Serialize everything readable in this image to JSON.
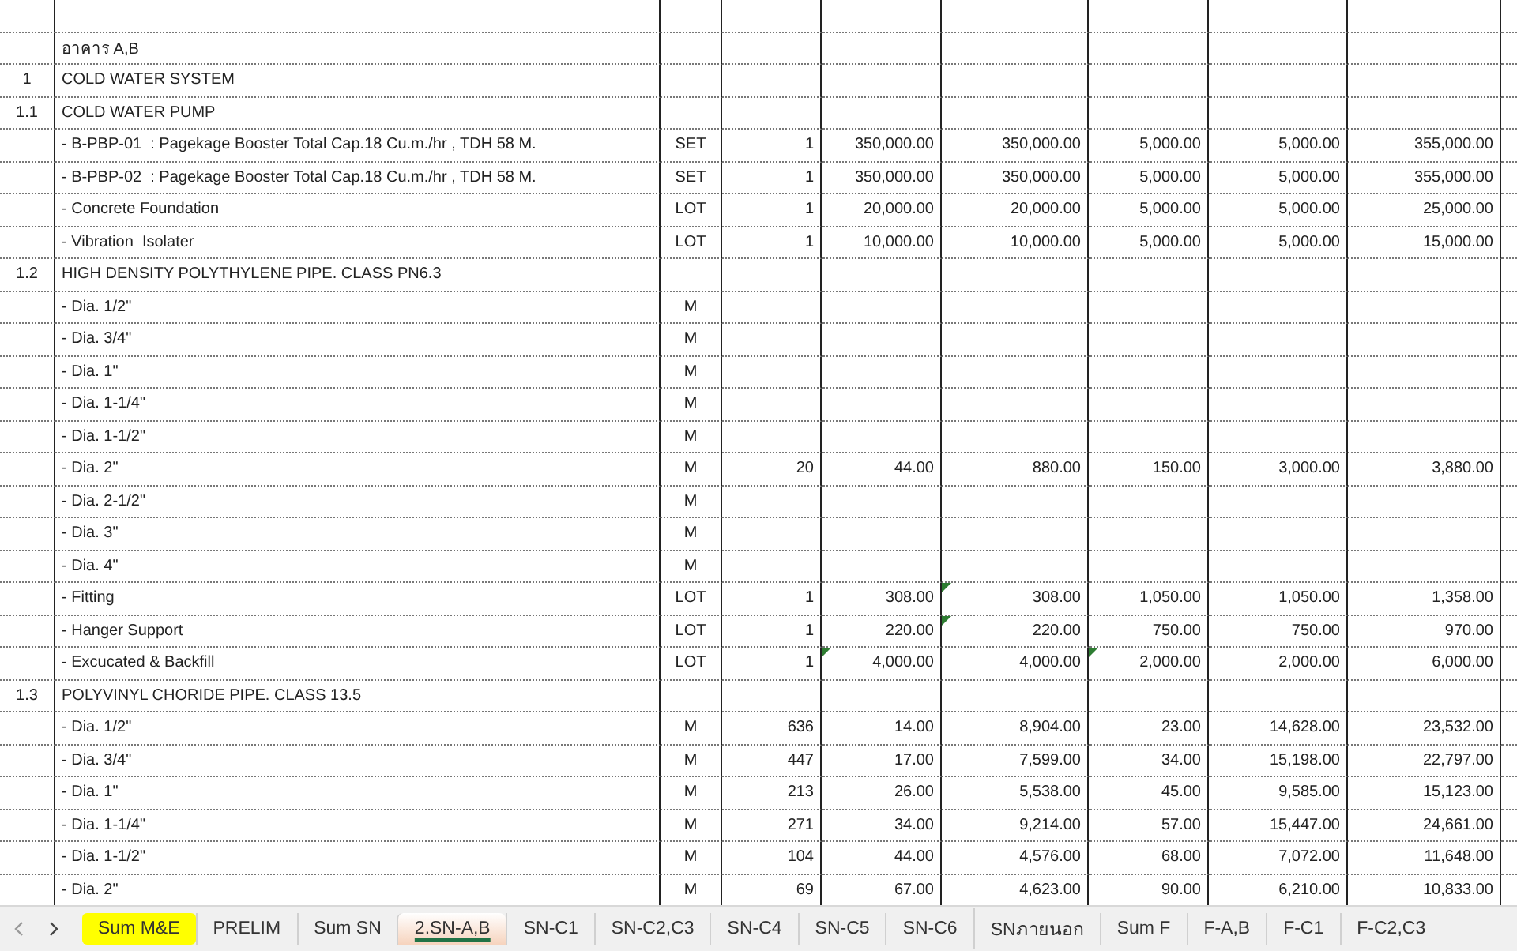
{
  "sheet": {
    "rows": [
      {
        "cells": []
      },
      {
        "cells": [
          null,
          "อาคาร A,B"
        ]
      },
      {
        "cells": [
          "1",
          "COLD WATER SYSTEM"
        ]
      },
      {
        "cells": [
          "1.1",
          "COLD WATER PUMP"
        ]
      },
      {
        "cells": [
          null,
          "- B-PBP-01  : Pagekage Booster Total Cap.18 Cu.m./hr , TDH 58 M.",
          "SET",
          "1",
          "350,000.00",
          "350,000.00",
          "5,000.00",
          "5,000.00",
          "355,000.00"
        ]
      },
      {
        "cells": [
          null,
          "- B-PBP-02  : Pagekage Booster Total Cap.18 Cu.m./hr , TDH 58 M.",
          "SET",
          "1",
          "350,000.00",
          "350,000.00",
          "5,000.00",
          "5,000.00",
          "355,000.00"
        ]
      },
      {
        "cells": [
          null,
          "- Concrete Foundation",
          "LOT",
          "1",
          "20,000.00",
          "20,000.00",
          "5,000.00",
          "5,000.00",
          "25,000.00"
        ]
      },
      {
        "cells": [
          null,
          "- Vibration  Isolater",
          "LOT",
          "1",
          "10,000.00",
          "10,000.00",
          "5,000.00",
          "5,000.00",
          "15,000.00"
        ]
      },
      {
        "cells": [
          "1.2",
          "HIGH DENSITY POLYTHYLENE PIPE. CLASS PN6.3"
        ]
      },
      {
        "cells": [
          null,
          "- Dia. 1/2\"",
          "M"
        ]
      },
      {
        "cells": [
          null,
          "- Dia. 3/4\"",
          "M"
        ]
      },
      {
        "cells": [
          null,
          "- Dia. 1\"",
          "M"
        ]
      },
      {
        "cells": [
          null,
          "- Dia. 1-1/4\"",
          "M"
        ]
      },
      {
        "cells": [
          null,
          "- Dia. 1-1/2\"",
          "M"
        ]
      },
      {
        "cells": [
          null,
          "- Dia. 2\"",
          "M",
          "20",
          "44.00",
          "880.00",
          "150.00",
          "3,000.00",
          "3,880.00"
        ]
      },
      {
        "cells": [
          null,
          "- Dia. 2-1/2\"",
          "M"
        ]
      },
      {
        "cells": [
          null,
          "- Dia. 3\"",
          "M"
        ]
      },
      {
        "cells": [
          null,
          "- Dia. 4\"",
          "M"
        ]
      },
      {
        "cells": [
          null,
          "- Fitting",
          "LOT",
          "1",
          "308.00",
          {
            "text": "308.00",
            "error_mark": true
          },
          "1,050.00",
          "1,050.00",
          "1,358.00"
        ]
      },
      {
        "cells": [
          null,
          "- Hanger Support",
          "LOT",
          "1",
          "220.00",
          {
            "text": "220.00",
            "error_mark": true
          },
          "750.00",
          "750.00",
          "970.00"
        ]
      },
      {
        "cells": [
          null,
          "- Excucated & Backfill",
          "LOT",
          "1",
          {
            "text": "4,000.00",
            "error_mark": true
          },
          "4,000.00",
          {
            "text": "2,000.00",
            "error_mark": true
          },
          "2,000.00",
          "6,000.00"
        ]
      },
      {
        "cells": [
          "1.3",
          "POLYVINYL CHORIDE PIPE. CLASS 13.5"
        ]
      },
      {
        "cells": [
          null,
          "- Dia. 1/2\"",
          "M",
          "636",
          "14.00",
          "8,904.00",
          "23.00",
          "14,628.00",
          "23,532.00"
        ]
      },
      {
        "cells": [
          null,
          "- Dia. 3/4\"",
          "M",
          "447",
          "17.00",
          "7,599.00",
          "34.00",
          "15,198.00",
          "22,797.00"
        ]
      },
      {
        "cells": [
          null,
          "- Dia. 1\"",
          "M",
          "213",
          "26.00",
          "5,538.00",
          "45.00",
          "9,585.00",
          "15,123.00"
        ]
      },
      {
        "cells": [
          null,
          "- Dia. 1-1/4\"",
          "M",
          "271",
          "34.00",
          "9,214.00",
          "57.00",
          "15,447.00",
          "24,661.00"
        ]
      },
      {
        "cells": [
          null,
          "- Dia. 1-1/2\"",
          "M",
          "104",
          "44.00",
          "4,576.00",
          "68.00",
          "7,072.00",
          "11,648.00"
        ]
      },
      {
        "cells": [
          null,
          "- Dia. 2\"",
          "M",
          "69",
          "67.00",
          "4,623.00",
          "90.00",
          "6,210.00",
          "10,833.00"
        ]
      }
    ]
  },
  "sheet_tabs": [
    {
      "label": "Sum M&E",
      "selected": false,
      "color": "#ffff00"
    },
    {
      "label": "PRELIM",
      "selected": false
    },
    {
      "label": "Sum SN",
      "selected": false
    },
    {
      "label": "2.SN-A,B",
      "selected": true
    },
    {
      "label": "SN-C1",
      "selected": false
    },
    {
      "label": "SN-C2,C3",
      "selected": false
    },
    {
      "label": "SN-C4",
      "selected": false
    },
    {
      "label": "SN-C5",
      "selected": false
    },
    {
      "label": "SN-C6",
      "selected": false
    },
    {
      "label": "SNภายนอก",
      "selected": false
    },
    {
      "label": "Sum F",
      "selected": false
    },
    {
      "label": "F-A,B",
      "selected": false
    },
    {
      "label": "F-C1",
      "selected": false
    },
    {
      "label": "F-C2,C3",
      "selected": false
    }
  ]
}
